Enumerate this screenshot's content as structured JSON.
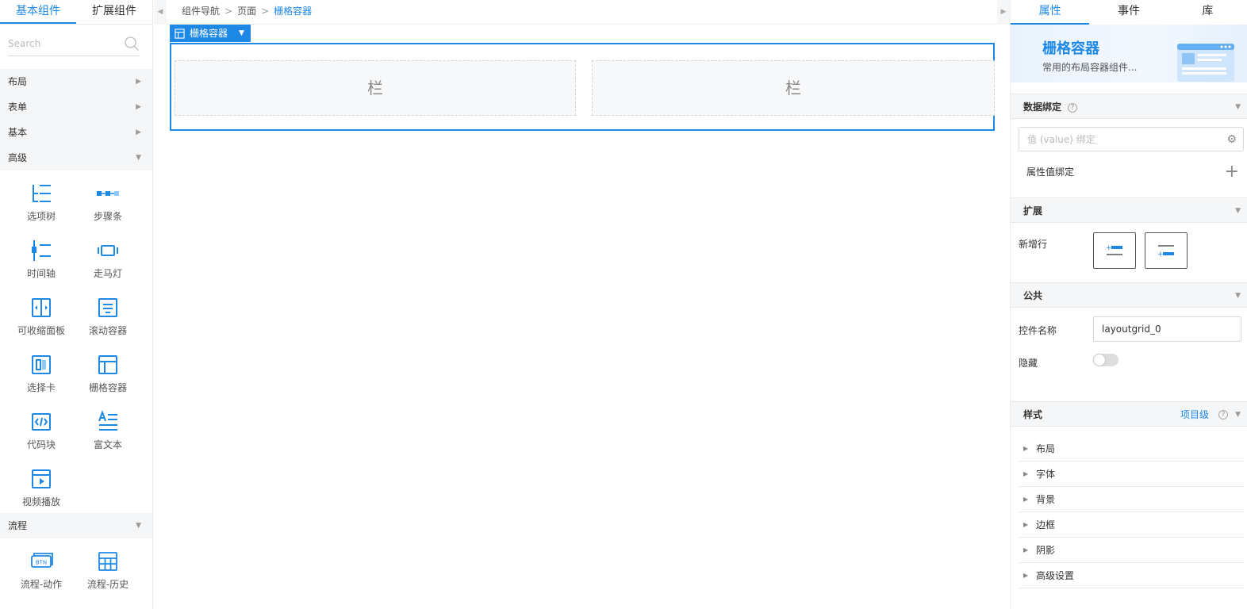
{
  "left": {
    "tabs": [
      "基本组件",
      "扩展组件"
    ],
    "search_placeholder": "Search",
    "categories": {
      "layout": "布局",
      "form": "表单",
      "basic": "基本",
      "advanced": "高级",
      "flow": "流程"
    },
    "advanced_items": [
      "选项树",
      "步骤条",
      "时间轴",
      "走马灯",
      "可收缩面板",
      "滚动容器",
      "选择卡",
      "栅格容器",
      "代码块",
      "富文本",
      "视频播放"
    ],
    "flow_items": [
      "流程-动作",
      "流程-历史"
    ]
  },
  "center": {
    "breadcrumbs": [
      "组件导航",
      "页面",
      "栅格容器"
    ],
    "selected_tag": "栅格容器",
    "columns": [
      "栏",
      "栏"
    ]
  },
  "right": {
    "tabs": [
      "属性",
      "事件",
      "库"
    ],
    "banner_title": "栅格容器",
    "banner_subtitle": "常用的布局容器组件...",
    "data_binding": {
      "title": "数据绑定",
      "value_placeholder": "值 (value) 绑定",
      "attr_binding": "属性值绑定"
    },
    "extend": {
      "title": "扩展",
      "new_row": "新增行"
    },
    "public": {
      "title": "公共",
      "control_name_label": "控件名称",
      "control_name_value": "layoutgrid_0",
      "hidden_label": "隐藏",
      "hidden": false
    },
    "style": {
      "title": "样式",
      "level": "项目级",
      "items": [
        "布局",
        "字体",
        "背景",
        "边框",
        "阴影",
        "高级设置"
      ]
    }
  },
  "colors": {
    "accent": "#1e88e5",
    "panel_bg": "#f5f6f8"
  }
}
